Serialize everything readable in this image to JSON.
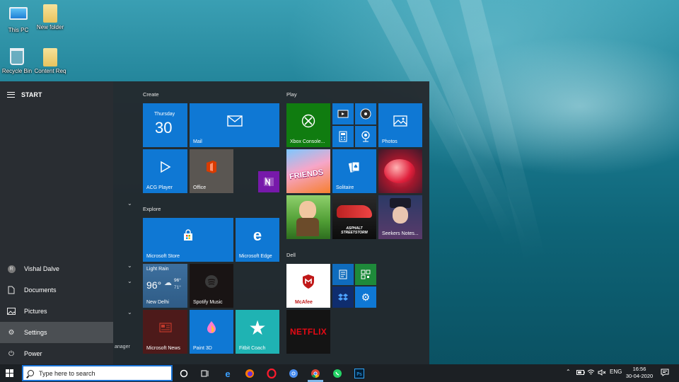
{
  "desktop": {
    "icons": [
      {
        "label": "This PC",
        "icon": "this-pc-icon"
      },
      {
        "label": "New folder",
        "icon": "folder-icon"
      },
      {
        "label": "Recycle Bin",
        "icon": "recycle-bin-icon"
      },
      {
        "label": "Content Req",
        "icon": "folder-icon"
      }
    ]
  },
  "start": {
    "title": "START",
    "rail": {
      "user": "Vishal Dalve",
      "items": [
        {
          "label": "Documents",
          "icon": "document-icon"
        },
        {
          "label": "Pictures",
          "icon": "pictures-icon"
        },
        {
          "label": "Settings",
          "icon": "gear-icon"
        },
        {
          "label": "Power",
          "icon": "power-icon"
        }
      ],
      "peek_text": "anager"
    },
    "groups": {
      "create": "Create",
      "explore": "Explore",
      "play": "Play",
      "dell": "Dell"
    },
    "tiles": {
      "calendar": {
        "day": "Thursday",
        "date": "30"
      },
      "mail": "Mail",
      "acg_player": "ACG Player",
      "office": "Office",
      "ms_store": "Microsoft Store",
      "ms_edge": "Microsoft Edge",
      "weather": {
        "condition": "Light Rain",
        "temp": "96°",
        "high": "96°",
        "low": "71°",
        "city": "New Delhi"
      },
      "spotify": "Spotify Music",
      "ms_news": "Microsoft News",
      "paint3d": "Paint 3D",
      "fitbit": "Fitbit Coach",
      "xbox": "Xbox Console...",
      "photos": "Photos",
      "friends_art": "FRIENDS",
      "solitaire": "Solitaire",
      "asphalt_art": "ASPHALT STREETSTORM",
      "seekers": "Seekers Notes...",
      "mcafee": "McAfee",
      "netflix": "NETFLIX"
    }
  },
  "taskbar": {
    "search_placeholder": "Type here to search",
    "lang": "ENG",
    "time": "16:56",
    "date": "30-04-2020"
  },
  "colors": {
    "tile_blue": "#0f78d4",
    "taskbar": "#1c2024",
    "start_bg": "#24282c"
  }
}
